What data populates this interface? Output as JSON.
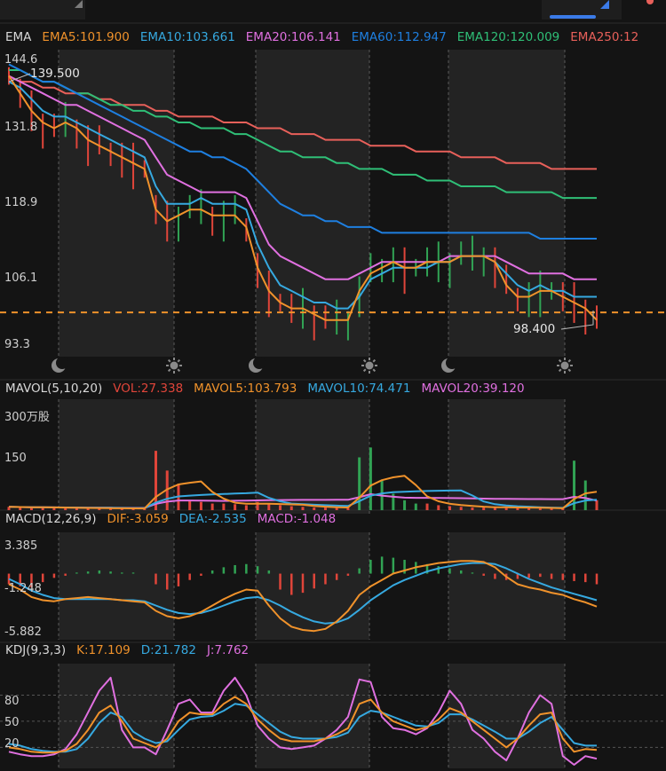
{
  "colors": {
    "bg": "#141414",
    "panel": "#1b1b1b",
    "shade": "#232323",
    "grid": "#5a5a5a",
    "up": "#31a354",
    "down": "#e0453a",
    "orange": "#f0922b",
    "blue": "#36a9e0",
    "pink": "#e070e0",
    "ema60": "#1e7fe0",
    "ema120": "#2fbf77",
    "ema250": "#e8605a",
    "text": "#d8d8d8",
    "accent": "#3b7be8"
  },
  "main": {
    "legend": {
      "title": "EMA",
      "items": [
        {
          "label": "EMA5:101.900",
          "color": "#f0922b"
        },
        {
          "label": "EMA10:103.661",
          "color": "#36a9e0"
        },
        {
          "label": "EMA20:106.141",
          "color": "#e070e0"
        },
        {
          "label": "EMA60:112.947",
          "color": "#1e7fe0"
        },
        {
          "label": "EMA120:120.009",
          "color": "#2fbf77"
        },
        {
          "label": "EMA250:12",
          "color": "#e8605a"
        }
      ]
    },
    "y_labels": [
      "144.6",
      "131.8",
      "118.9",
      "106.1",
      "93.3"
    ],
    "high_label": "139.500",
    "low_label": "98.400",
    "current_price_line": 100.3,
    "ylim": [
      93.3,
      144.6
    ],
    "time_icons": [
      "moon-icon",
      "sun-icon",
      "moon-icon",
      "sun-icon",
      "moon-icon",
      "sun-icon"
    ]
  },
  "volume": {
    "legend": {
      "title": "MAVOL(5,10,20)",
      "items": [
        {
          "label": "VOL:27.338",
          "color": "#e0453a"
        },
        {
          "label": "MAVOL5:103.793",
          "color": "#f0922b"
        },
        {
          "label": "MAVOL10:74.471",
          "color": "#36a9e0"
        },
        {
          "label": "MAVOL20:39.120",
          "color": "#e070e0"
        }
      ]
    },
    "y_labels": [
      "300万股",
      "150"
    ]
  },
  "macd": {
    "legend": {
      "title": "MACD(12,26,9)",
      "items": [
        {
          "label": "DIF:-3.059",
          "color": "#f0922b"
        },
        {
          "label": "DEA:-2.535",
          "color": "#36a9e0"
        },
        {
          "label": "MACD:-1.048",
          "color": "#e070e0"
        }
      ]
    },
    "y_labels": [
      "3.385",
      "-1.248",
      "-5.882"
    ]
  },
  "kdj": {
    "legend": {
      "title": "KDJ(9,3,3)",
      "items": [
        {
          "label": "K:17.109",
          "color": "#f0922b"
        },
        {
          "label": "D:21.782",
          "color": "#36a9e0"
        },
        {
          "label": "J:7.762",
          "color": "#e070e0"
        }
      ]
    },
    "y_labels": [
      "80",
      "50",
      "20"
    ]
  },
  "chart_data": [
    {
      "type": "line",
      "series": [
        {
          "name": "EMA5",
          "values": [
            141,
            138,
            135,
            133,
            132,
            133,
            132,
            130,
            129,
            128,
            127,
            126,
            125,
            118,
            116,
            117,
            118,
            118,
            117,
            117,
            117,
            115,
            108,
            104,
            102,
            101,
            101,
            100,
            99,
            99,
            99,
            104,
            107,
            108,
            109,
            108,
            108,
            109,
            109,
            109,
            110,
            110,
            110,
            109,
            105,
            103,
            103,
            104,
            104,
            103,
            102,
            101,
            99
          ]
        },
        {
          "name": "EMA10",
          "values": [
            140,
            139,
            137,
            135,
            134,
            134,
            133,
            132,
            131,
            130,
            129,
            128,
            127,
            122,
            119,
            119,
            119,
            120,
            119,
            119,
            119,
            118,
            112,
            108,
            105,
            104,
            103,
            102,
            102,
            101,
            101,
            103,
            106,
            107,
            108,
            108,
            108,
            108,
            109,
            109,
            110,
            110,
            110,
            109,
            107,
            105,
            104,
            105,
            104,
            104,
            103,
            103,
            103
          ]
        },
        {
          "name": "EMA20",
          "values": [
            141,
            140,
            139,
            138,
            137,
            136,
            136,
            135,
            134,
            133,
            132,
            131,
            130,
            127,
            124,
            123,
            122,
            121,
            121,
            121,
            121,
            120,
            116,
            112,
            110,
            109,
            108,
            107,
            106,
            106,
            106,
            107,
            108,
            109,
            109,
            109,
            109,
            109,
            109,
            110,
            110,
            110,
            110,
            110,
            109,
            108,
            107,
            107,
            107,
            107,
            106,
            106,
            106
          ]
        },
        {
          "name": "EMA60",
          "values": [
            143,
            142,
            141,
            140,
            140,
            139,
            138,
            137,
            136,
            135,
            134,
            133,
            132,
            131,
            130,
            129,
            128,
            128,
            127,
            127,
            126,
            125,
            123,
            121,
            119,
            118,
            117,
            117,
            116,
            116,
            115,
            115,
            115,
            114,
            114,
            114,
            114,
            114,
            114,
            114,
            114,
            114,
            114,
            114,
            114,
            114,
            114,
            113,
            113,
            113,
            113,
            113,
            113
          ]
        },
        {
          "name": "EMA120",
          "values": [
            142,
            142,
            141,
            140,
            140,
            139,
            138,
            138,
            137,
            136,
            136,
            135,
            135,
            134,
            134,
            133,
            133,
            132,
            132,
            132,
            131,
            131,
            130,
            129,
            128,
            128,
            127,
            127,
            127,
            126,
            126,
            125,
            125,
            125,
            124,
            124,
            124,
            123,
            123,
            123,
            122,
            122,
            122,
            122,
            121,
            121,
            121,
            121,
            121,
            120,
            120,
            120,
            120
          ]
        },
        {
          "name": "EMA250",
          "values": [
            141,
            140,
            140,
            139,
            139,
            138,
            138,
            138,
            137,
            137,
            136,
            136,
            136,
            135,
            135,
            134,
            134,
            134,
            134,
            133,
            133,
            133,
            132,
            132,
            132,
            131,
            131,
            131,
            130,
            130,
            130,
            130,
            129,
            129,
            129,
            129,
            128,
            128,
            128,
            128,
            127,
            127,
            127,
            127,
            126,
            126,
            126,
            126,
            125,
            125,
            125,
            125,
            125
          ]
        }
      ],
      "ylim": [
        93.3,
        144.6
      ]
    },
    {
      "type": "bar",
      "name": "volume",
      "ylim": [
        0,
        320
      ],
      "values": [
        10,
        9,
        8,
        8,
        7,
        7,
        6,
        6,
        6,
        5,
        5,
        5,
        5,
        180,
        120,
        80,
        30,
        25,
        20,
        20,
        18,
        15,
        25,
        20,
        15,
        12,
        10,
        8,
        8,
        7,
        7,
        160,
        190,
        90,
        50,
        30,
        20,
        20,
        15,
        12,
        10,
        8,
        8,
        7,
        10,
        8,
        6,
        5,
        4,
        5,
        150,
        90,
        30
      ]
    },
    {
      "type": "bar",
      "name": "macd-histogram",
      "ylim": [
        -5.882,
        3.385
      ],
      "values": [
        -1,
        -1.2,
        -1.3,
        -0.8,
        -0.4,
        -0.2,
        0.1,
        0.2,
        0.3,
        0.2,
        0.1,
        0.1,
        0,
        -1,
        -1.5,
        -1.2,
        -0.6,
        -0.2,
        0.3,
        0.6,
        0.8,
        0.9,
        0.7,
        0.3,
        -1.5,
        -2,
        -1.8,
        -1.4,
        -1,
        -0.6,
        -0.2,
        0.5,
        1.3,
        1.6,
        1.5,
        1.3,
        1.1,
        0.9,
        0.7,
        0.5,
        0.3,
        0.1,
        -0.2,
        -0.5,
        -0.6,
        -0.5,
        -0.4,
        -0.3,
        -0.5,
        -0.6,
        -0.7,
        -0.8,
        -1
      ]
    },
    {
      "type": "line",
      "name": "macd-lines",
      "ylim": [
        -5.882,
        3.385
      ],
      "series": [
        {
          "name": "DIF",
          "values": [
            -1,
            -1.5,
            -2.2,
            -2.5,
            -2.6,
            -2.4,
            -2.3,
            -2.2,
            -2.3,
            -2.4,
            -2.5,
            -2.6,
            -2.7,
            -3.5,
            -4,
            -4.2,
            -4,
            -3.6,
            -3,
            -2.4,
            -1.9,
            -1.5,
            -1.6,
            -3,
            -4.2,
            -5,
            -5.3,
            -5.4,
            -5.2,
            -4.5,
            -3.5,
            -2,
            -1.2,
            -0.6,
            0,
            0.3,
            0.6,
            0.8,
            1,
            1.1,
            1.2,
            1.2,
            1.1,
            0.6,
            -0.3,
            -1,
            -1.3,
            -1.5,
            -1.8,
            -2,
            -2.4,
            -2.7,
            -3.1
          ]
        },
        {
          "name": "DEA",
          "values": [
            -0.5,
            -1,
            -1.6,
            -2,
            -2.3,
            -2.4,
            -2.4,
            -2.4,
            -2.4,
            -2.4,
            -2.5,
            -2.5,
            -2.6,
            -3,
            -3.4,
            -3.7,
            -3.8,
            -3.7,
            -3.4,
            -3,
            -2.6,
            -2.3,
            -2.2,
            -2.5,
            -3,
            -3.6,
            -4.1,
            -4.5,
            -4.7,
            -4.6,
            -4.2,
            -3.4,
            -2.5,
            -1.8,
            -1.1,
            -0.6,
            -0.2,
            0.2,
            0.5,
            0.7,
            0.9,
            1,
            1,
            0.9,
            0.5,
            0,
            -0.5,
            -0.9,
            -1.3,
            -1.6,
            -1.9,
            -2.2,
            -2.5
          ]
        }
      ]
    },
    {
      "type": "line",
      "name": "kdj",
      "ylim": [
        0,
        110
      ],
      "series": [
        {
          "name": "K",
          "values": [
            20,
            18,
            15,
            14,
            14,
            16,
            24,
            40,
            60,
            68,
            50,
            30,
            25,
            20,
            30,
            50,
            60,
            58,
            58,
            70,
            78,
            70,
            52,
            40,
            30,
            27,
            27,
            27,
            30,
            35,
            42,
            70,
            75,
            60,
            50,
            45,
            40,
            43,
            52,
            65,
            60,
            50,
            40,
            30,
            20,
            30,
            45,
            58,
            60,
            30,
            15,
            18,
            17
          ]
        },
        {
          "name": "D",
          "values": [
            24,
            22,
            18,
            16,
            15,
            15,
            18,
            30,
            48,
            60,
            55,
            38,
            30,
            25,
            27,
            40,
            52,
            55,
            56,
            62,
            70,
            68,
            58,
            48,
            38,
            32,
            30,
            30,
            30,
            32,
            37,
            55,
            62,
            60,
            55,
            50,
            45,
            44,
            48,
            58,
            58,
            52,
            45,
            38,
            30,
            30,
            38,
            48,
            55,
            40,
            25,
            22,
            22
          ]
        },
        {
          "name": "J",
          "values": [
            15,
            12,
            10,
            10,
            12,
            18,
            35,
            60,
            85,
            100,
            40,
            20,
            20,
            12,
            40,
            70,
            75,
            60,
            60,
            85,
            100,
            80,
            45,
            30,
            20,
            18,
            20,
            22,
            30,
            40,
            55,
            98,
            95,
            55,
            42,
            40,
            35,
            42,
            60,
            85,
            70,
            40,
            30,
            15,
            5,
            30,
            60,
            80,
            70,
            10,
            0,
            10,
            7
          ]
        }
      ]
    }
  ]
}
